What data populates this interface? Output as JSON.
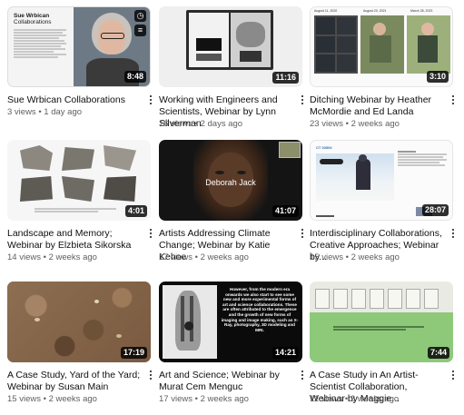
{
  "videos": [
    {
      "title": "Sue Wrbican Collaborations",
      "views": "3 views",
      "age": "1 day ago",
      "duration": "8:48",
      "thumb_title": "Sue Wrbican",
      "thumb_subtitle": "Collaborations"
    },
    {
      "title": "Working with Engineers and Scientists, Webinar by Lynn Silverman",
      "views": "16 views",
      "age": "2 days ago",
      "duration": "11:16"
    },
    {
      "title": "Ditching Webinar by Heather McMordie and Ed Landa",
      "views": "23 views",
      "age": "2 weeks ago",
      "duration": "3:10",
      "thumb_dates": [
        "August 11, 2020",
        "August 20, 2021",
        "March 28, 2023"
      ]
    },
    {
      "title": "Landscape and Memory; Webinar by Elzbieta Sikorska",
      "views": "14 views",
      "age": "2 weeks ago",
      "duration": "4:01"
    },
    {
      "title": "Artists Addressing Climate Change; Webinar by Katie Kehoe",
      "views": "17 views",
      "age": "2 weeks ago",
      "duration": "41:07",
      "thumb_caption": "Deborah Jack"
    },
    {
      "title": "Interdisciplinary Collaborations, Creative Approaches; Webinar by...",
      "views": "15 views",
      "age": "2 weeks ago",
      "duration": "28:07",
      "thumb_label": "CT 03500"
    },
    {
      "title": "A Case Study, Yard of the Yard; Webinar by Susan Main",
      "views": "15 views",
      "age": "2 weeks ago",
      "duration": "17:19"
    },
    {
      "title": "Art and Science; Webinar by Murat Cem Menguc",
      "views": "17 views",
      "age": "2 weeks ago",
      "duration": "14:21",
      "thumb_text": "However, from the modern era onwards we also start to see some new and more experimental forms of art and science collaborations. These are often attributed to the emergence and the growth of new forms of imaging and image making, such as X-Ray, photography, 3D modeling and MRI."
    },
    {
      "title": "A Case Study in An Artist-Scientist Collaboration, Webinar by Maggie...",
      "views": "11 views",
      "age": "2 weeks ago",
      "duration": "7:44"
    }
  ],
  "separator": "•",
  "colors": {
    "text": "#0f0f0f",
    "meta": "#606060",
    "duration_bg": "#000000"
  }
}
